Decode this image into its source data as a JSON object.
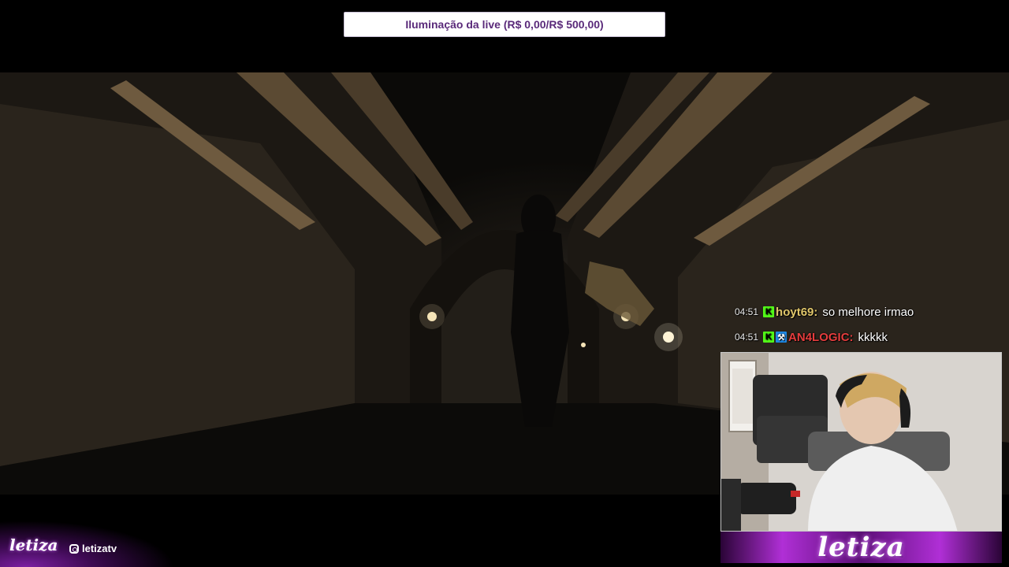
{
  "goal": {
    "text": "Iluminação da live (R$ 0,00/R$ 500,00)"
  },
  "chat": [
    {
      "time": "04:51",
      "badges": [
        "kick-badge"
      ],
      "user": "hoyt69:",
      "user_color": "#e0c66a",
      "message": "so melhore irmao"
    },
    {
      "time": "04:51",
      "badges": [
        "kick-badge",
        "tool-badge"
      ],
      "user": "AN4LOGIC:",
      "user_color": "#e53d3d",
      "message": "kkkkk"
    }
  ],
  "webcam": {
    "logo": "letiza"
  },
  "branding": {
    "logo": "letiza",
    "social_handle": "letizatv",
    "social_icon": "instagram-icon"
  },
  "colors": {
    "accent": "#b02fd6",
    "goal_text": "#5a2a7a",
    "kick_badge": "#53fc18"
  }
}
